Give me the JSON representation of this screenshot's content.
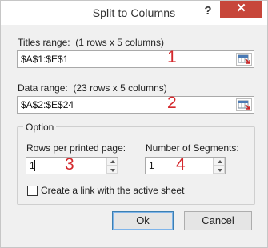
{
  "window": {
    "title": "Split to Columns",
    "help_label": "?",
    "close_label": "✕"
  },
  "titles_range": {
    "label": "Titles range:",
    "info": "(1 rows x 5 columns)",
    "value": "$A$1:$E$1",
    "marker": "1"
  },
  "data_range": {
    "label": "Data range:",
    "info": "(23 rows x 5 columns)",
    "value": "$A$2:$E$24",
    "marker": "2"
  },
  "option": {
    "title": "Option",
    "rows_per_page": {
      "label": "Rows per printed page:",
      "value": "1",
      "marker": "3"
    },
    "segments": {
      "label": "Number of Segments:",
      "value": "1",
      "marker": "4"
    },
    "link_checkbox": {
      "label": "Create a link with the active sheet",
      "checked": false
    }
  },
  "buttons": {
    "ok": "Ok",
    "cancel": "Cancel"
  }
}
